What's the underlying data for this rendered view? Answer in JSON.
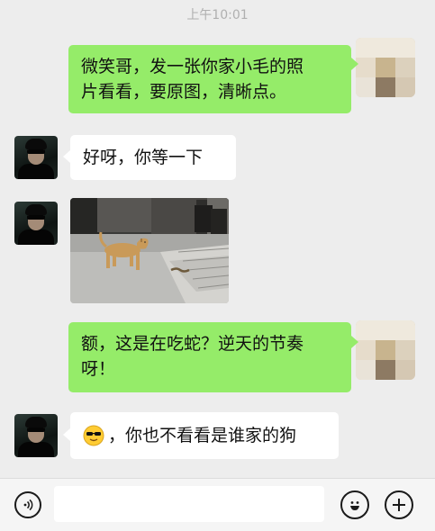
{
  "chat": {
    "timestamp": "上午10:01",
    "messages": [
      {
        "from": "self",
        "type": "text",
        "lines": [
          "微笑哥，发一张你家小毛的照",
          "片看看，要原图，清晰点。"
        ]
      },
      {
        "from": "other",
        "type": "text",
        "text": "好呀，你等一下"
      },
      {
        "from": "other",
        "type": "image",
        "image_desc": "dog-photo"
      },
      {
        "from": "self",
        "type": "text",
        "lines": [
          "额，这是在吃蛇？逆天的节奏",
          "呀！"
        ]
      },
      {
        "from": "other",
        "type": "text",
        "text": "，你也不看看是谁家的狗",
        "emoji": "sunglasses-emoji"
      }
    ]
  },
  "input_bar": {
    "voice_icon": "voice-icon",
    "emoji_icon": "emoji-icon",
    "plus_icon": "plus-icon",
    "text_value": ""
  },
  "colors": {
    "background": "#ededed",
    "self_bubble": "#95ec69",
    "other_bubble": "#ffffff",
    "timestamp": "#b0b0b0"
  }
}
